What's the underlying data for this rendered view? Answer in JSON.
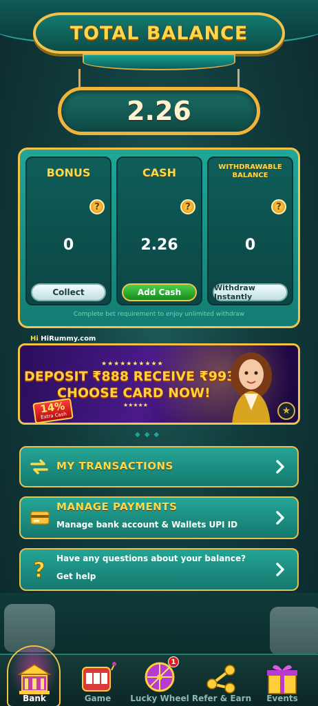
{
  "header": {
    "title": "TOTAL BALANCE",
    "total_balance": "2.26"
  },
  "wallet": {
    "cards": [
      {
        "label": "BONUS",
        "value": "0",
        "button": "Collect"
      },
      {
        "label": "CASH",
        "value": "2.26",
        "button": "Add Cash"
      },
      {
        "label": "WITHDRAWABLE BALANCE",
        "value": "0",
        "button": "Withdraw Instantly"
      }
    ],
    "help_glyph": "?",
    "note": "Complete bet requirement to enjoy unlimited withdraw"
  },
  "banner": {
    "brand_hi": "Hi",
    "brand": "HiRummy.com",
    "line1": "DEPOSIT ₹888 RECEIVE ₹993",
    "line2": "CHOOSE CARD NOW!",
    "tag_percent": "14%",
    "tag_sub": "Extra Cash",
    "stars_top": "★★★★★★★★★★",
    "stars_bottom": "★★★★★"
  },
  "rows": {
    "transactions": {
      "title": "MY TRANSACTIONS"
    },
    "payments": {
      "title": "MANAGE PAYMENTS",
      "subtitle": "Manage bank account & Wallets UPI ID"
    },
    "help": {
      "question": "Have any questions about your balance?",
      "subtitle": "Get help"
    }
  },
  "bottom_nav": {
    "items": [
      {
        "label": "Bank",
        "active": true
      },
      {
        "label": "Game"
      },
      {
        "label": "Lucky Wheel",
        "badge": "1"
      },
      {
        "label": "Refer & Earn"
      },
      {
        "label": "Events"
      }
    ]
  },
  "colors": {
    "accent_gold": "#f2c24b",
    "teal": "#1fa79a",
    "title_yellow": "#ffd84a"
  }
}
